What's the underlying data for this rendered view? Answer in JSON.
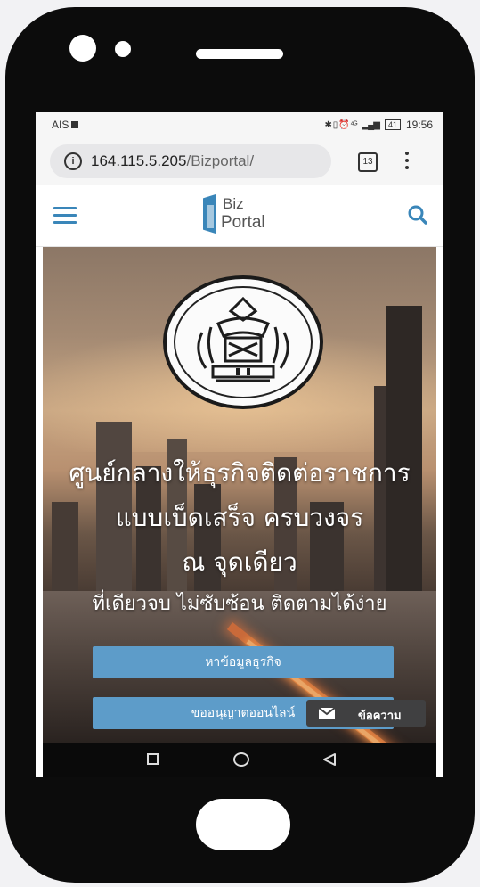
{
  "status": {
    "carrier": "AIS",
    "right_icons": "✱ ▯ ⏰ ⁴ᴳ",
    "battery": "41",
    "time": "19:56"
  },
  "browser": {
    "url_host": "164.115.5.205",
    "url_path": "/Bizportal/",
    "tab_count": "13",
    "info_glyph": "i"
  },
  "site": {
    "logo_top": "Biz",
    "logo_bottom": "Portal",
    "menu_icon": "hamburger-icon",
    "search_icon": "search-icon"
  },
  "hero": {
    "line1": "ศูนย์กลางให้ธุรกิจติดต่อราชการ",
    "line2": "แบบเบ็ดเสร็จ ครบวงจร",
    "line3": "ณ จุดเดียว",
    "line4": "ที่เดียวจบ ไม่ซับซ้อน ติดตามได้ง่าย"
  },
  "buttons": {
    "find_business": "หาข้อมูลธุรกิจ",
    "online_license": "ขออนุญาตออนไลน์"
  },
  "chat": {
    "label": "ข้อความ"
  },
  "colors": {
    "accent": "#3a86b9",
    "button": "#5d9cc9",
    "chat_bg": "#404041"
  }
}
